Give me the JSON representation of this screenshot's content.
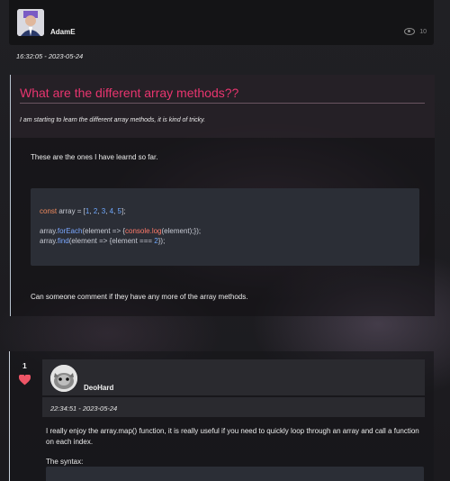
{
  "post": {
    "author": "AdamE",
    "views": "10",
    "timestamp": "16:32:05 - 2023-05-24",
    "title": "What are the different array methods??",
    "subtitle": "I am starting to learn the different array methods, it is kind of tricky.",
    "body_intro": "These are the ones I have learnd so far.",
    "code": {
      "line1": {
        "kw": "const",
        "rest": " array = [",
        "n1": "1",
        "c1": ", ",
        "n2": "2",
        "c2": ", ",
        "n3": "3",
        "c3": ", ",
        "n4": "4",
        "c4": ", ",
        "n5": "5",
        "end": "];"
      },
      "line2": {
        "a": "array.",
        "fn": "forEach",
        "b": "(element => {",
        "c": "console.log",
        "d": "(element);});"
      },
      "line3": {
        "a": "array.",
        "fn": "find",
        "b": "(element => {element === ",
        "n": "2",
        "d": "});"
      }
    },
    "body_outro": "Can someone comment if they have any more of the array methods."
  },
  "answer": {
    "votes": "1",
    "author": "DeoHard",
    "timestamp": "22:34:51 - 2023-05-24",
    "text": "I really enjoy the array.map() function, it is really useful if you need to quickly loop through an array and call a function on each index.",
    "syntax_label": "The syntax:"
  },
  "colors": {
    "title": "#e8356f",
    "heart": "#ee5566",
    "keyword": "#f08a5d",
    "number": "#6ea8ff"
  }
}
